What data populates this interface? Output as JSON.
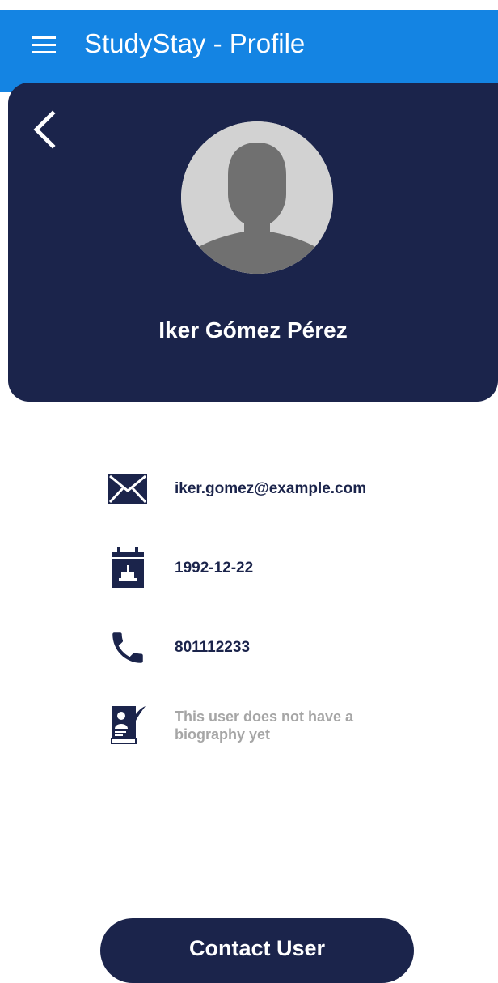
{
  "app_bar": {
    "title": "StudyStay - Profile",
    "menu_icon": "hamburger-menu-icon",
    "color": "#1484e3"
  },
  "profile": {
    "name": "Iker Gómez Pérez",
    "back_icon": "chevron-left-icon",
    "avatar_icon": "default-avatar-silhouette",
    "header_color": "#1b244b"
  },
  "details": {
    "email": "iker.gomez@example.com",
    "birthdate": "1992-12-22",
    "phone": "801112233",
    "biography": "This user does not have a biography yet",
    "icons": [
      "envelope-icon",
      "birthday-calendar-icon",
      "phone-icon",
      "biography-book-icon"
    ]
  },
  "actions": {
    "contact_label": "Contact User"
  }
}
